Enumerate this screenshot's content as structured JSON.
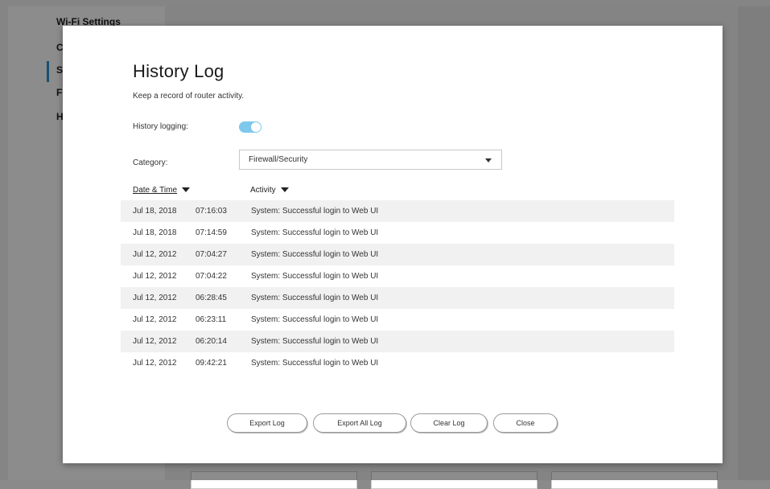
{
  "background": {
    "sidebar_items": [
      "Wi-Fi Settings",
      "C",
      "S",
      "F",
      "H"
    ]
  },
  "modal": {
    "title": "History Log",
    "subtitle": "Keep a record of router activity.",
    "logging_label": "History logging:",
    "logging_enabled": true,
    "category_label": "Category:",
    "category_value": "Firewall/Security",
    "columns": {
      "date_time": "Date & Time",
      "activity": "Activity"
    },
    "rows": [
      {
        "date": "Jul 18, 2018",
        "time": "07:16:03",
        "activity": "System: Successful login to Web UI"
      },
      {
        "date": "Jul 18, 2018",
        "time": "07:14:59",
        "activity": "System: Successful login to Web UI"
      },
      {
        "date": "Jul 12, 2012",
        "time": "07:04:27",
        "activity": "System: Successful login to Web UI"
      },
      {
        "date": "Jul 12, 2012",
        "time": "07:04:22",
        "activity": "System: Successful login to Web UI"
      },
      {
        "date": "Jul 12, 2012",
        "time": "06:28:45",
        "activity": "System: Successful login to Web UI"
      },
      {
        "date": "Jul 12, 2012",
        "time": "06:23:11",
        "activity": "System: Successful login to Web UI"
      },
      {
        "date": "Jul 12, 2012",
        "time": "06:20:14",
        "activity": "System: Successful login to Web UI"
      },
      {
        "date": "Jul 12, 2012",
        "time": "09:42:21",
        "activity": "System: Successful login to Web UI"
      }
    ],
    "buttons": {
      "export_log": "Export Log",
      "export_all_log": "Export All Log",
      "clear_log": "Clear Log",
      "close": "Close"
    }
  },
  "colors": {
    "accent": "#2f8fd0",
    "toggle_on": "#7ec8ee"
  }
}
